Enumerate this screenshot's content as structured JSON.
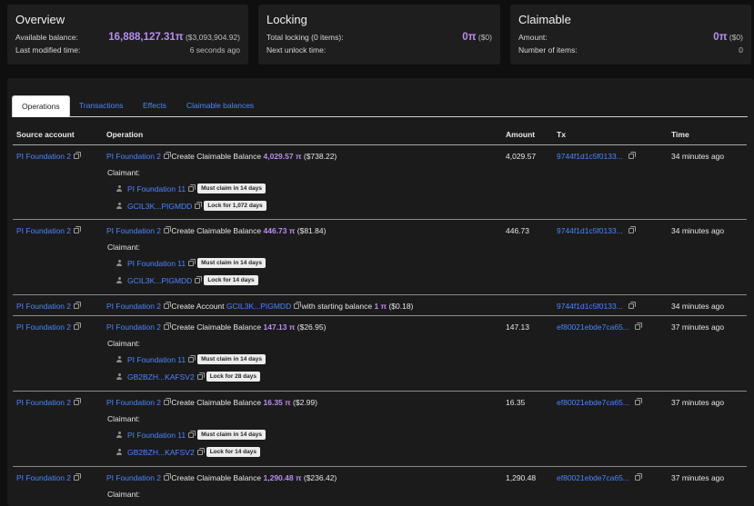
{
  "overview": {
    "title": "Overview",
    "available_label": "Available balance:",
    "available_value": "16,888,127.31π",
    "available_usd": "($3,093,904.92)",
    "modified_label": "Last modified time:",
    "modified_value": "6 seconds ago"
  },
  "locking": {
    "title": "Locking",
    "total_label": "Total locking (0 items):",
    "total_value": "0π",
    "total_usd": "($0)",
    "unlock_label": "Next unlock time:"
  },
  "claimable": {
    "title": "Claimable",
    "amount_label": "Amount:",
    "amount_value": "0π",
    "amount_usd": "($0)",
    "items_label": "Number of items:",
    "items_value": "0"
  },
  "tabs": [
    "Operations",
    "Transactions",
    "Effects",
    "Claimable balances"
  ],
  "columns": [
    "Source account",
    "Operation",
    "Amount",
    "Tx",
    "Time"
  ],
  "rows": [
    {
      "source": "PI Foundation 2",
      "op_source": "PI Foundation 2",
      "op_text": "Create Claimable Balance",
      "op_amount": "4,029.57 π",
      "op_usd": "($738.22)",
      "amount": "4,029.57",
      "tx": "9744f1d1c5f0133...",
      "time": "34 minutes ago",
      "claimant_label": "Claimant:",
      "claimants": [
        {
          "name": "PI Foundation 11",
          "badge": "Must claim in 14 days"
        },
        {
          "name": "GCIL3K...PIGMDD",
          "badge": "Lock for 1,072 days"
        }
      ]
    },
    {
      "source": "PI Foundation 2",
      "op_source": "PI Foundation 2",
      "op_text": "Create Claimable Balance",
      "op_amount": "446.73 π",
      "op_usd": "($81.84)",
      "amount": "446.73",
      "tx": "9744f1d1c5f0133...",
      "time": "34 minutes ago",
      "claimant_label": "Claimant:",
      "claimants": [
        {
          "name": "PI Foundation 11",
          "badge": "Must claim in 14 days"
        },
        {
          "name": "GCIL3K...PIGMDD",
          "badge": "Lock for 14 days"
        }
      ]
    },
    {
      "source": "PI Foundation 2",
      "op_source": "PI Foundation 2",
      "op_text": "Create Account",
      "op_account": "GCIL3K...PIGMDD",
      "op_text2": "with starting balance",
      "op_amount": "1 π",
      "op_usd": "($0.18)",
      "amount": "",
      "tx": "9744f1d1c5f0133...",
      "time": "34 minutes ago"
    },
    {
      "source": "PI Foundation 2",
      "op_source": "PI Foundation 2",
      "op_text": "Create Claimable Balance",
      "op_amount": "147.13 π",
      "op_usd": "($26.95)",
      "amount": "147.13",
      "tx": "ef80021ebde7ca65...",
      "time": "37 minutes ago",
      "claimant_label": "Claimant:",
      "claimants": [
        {
          "name": "PI Foundation 11",
          "badge": "Must claim in 14 days"
        },
        {
          "name": "GB2BZH...KAFSV2",
          "badge": "Lock for 28 days"
        }
      ]
    },
    {
      "source": "PI Foundation 2",
      "op_source": "PI Foundation 2",
      "op_text": "Create Claimable Balance",
      "op_amount": "16.35 π",
      "op_usd": "($2.99)",
      "amount": "16.35",
      "tx": "ef80021ebde7ca65...",
      "time": "37 minutes ago",
      "claimant_label": "Claimant:",
      "claimants": [
        {
          "name": "PI Foundation 11",
          "badge": "Must claim in 14 days"
        },
        {
          "name": "GB2BZH...KAFSV2",
          "badge": "Lock for 14 days"
        }
      ]
    },
    {
      "source": "PI Foundation 2",
      "op_source": "PI Foundation 2",
      "op_text": "Create Claimable Balance",
      "op_amount": "1,290.48 π",
      "op_usd": "($236.42)",
      "amount": "1,290.48",
      "tx": "ef80021ebde7ca65...",
      "time": "37 minutes ago",
      "claimant_label": "Claimant:",
      "claimants": []
    }
  ]
}
